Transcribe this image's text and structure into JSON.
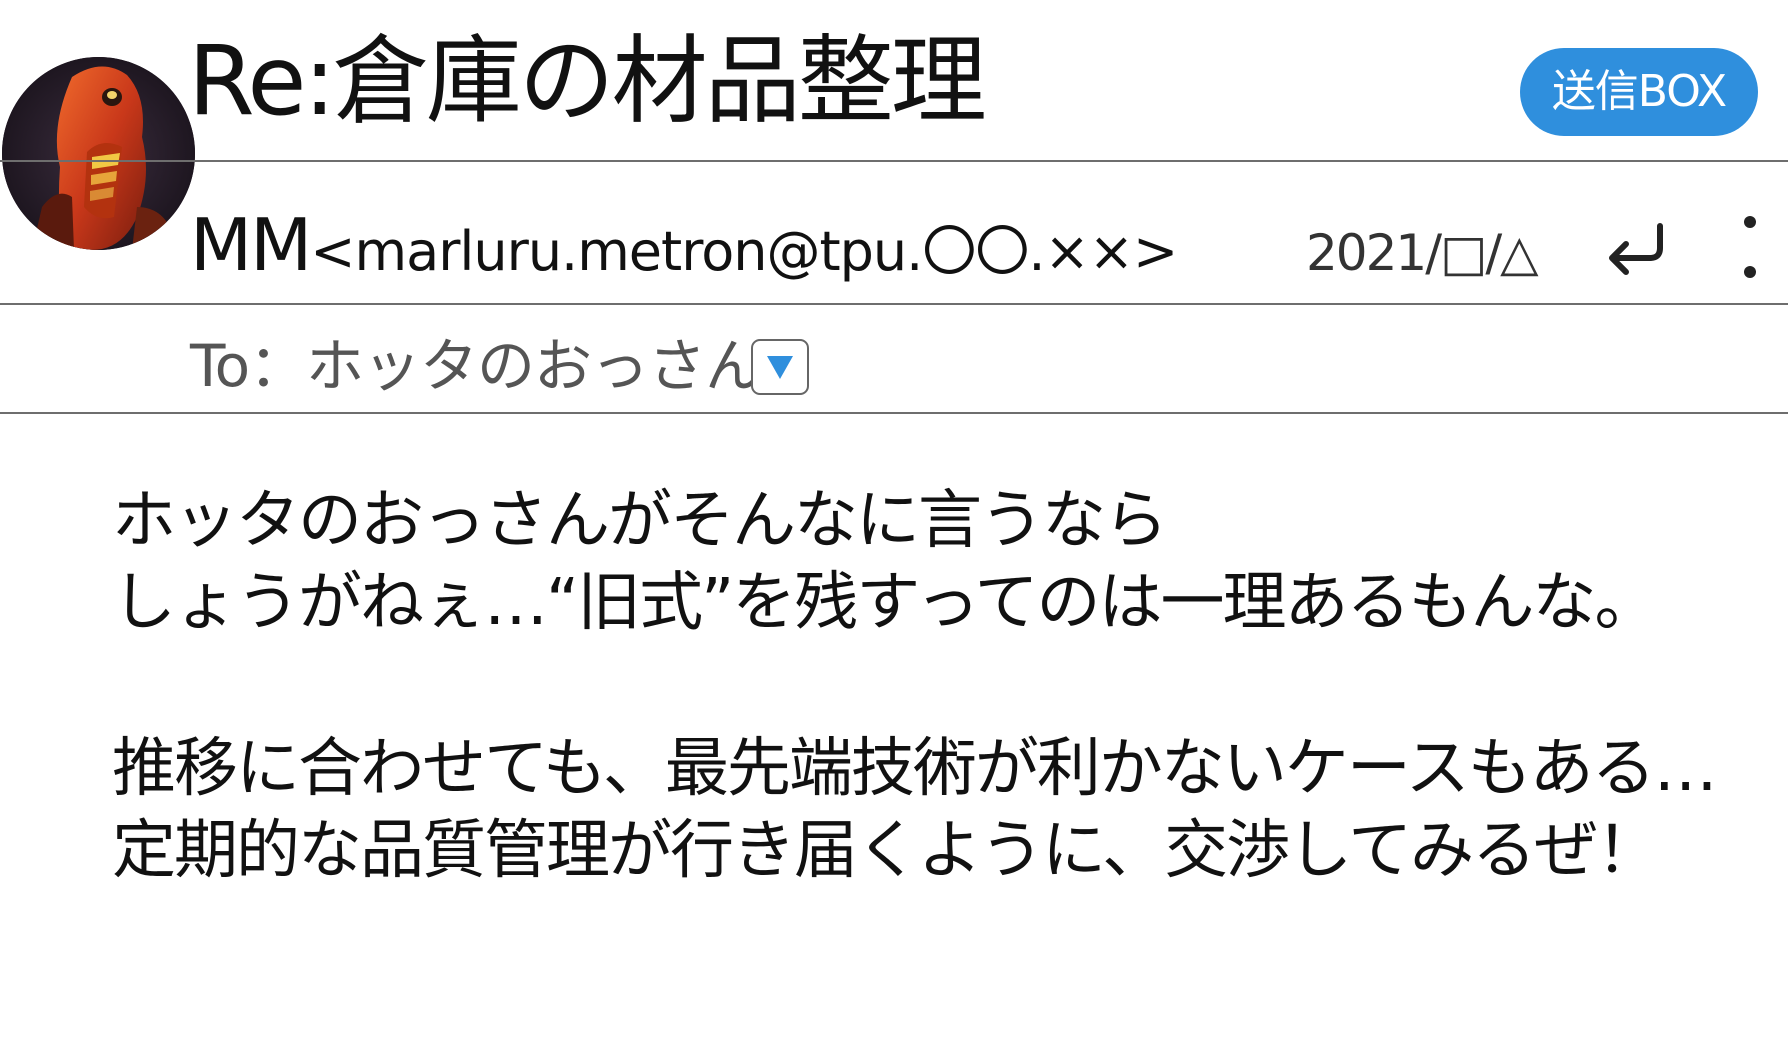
{
  "header": {
    "subject": "Re:倉庫の材品整理",
    "folder_badge": "送信BOX"
  },
  "message": {
    "sender_name": "MM",
    "sender_email": "<marluru.metron@tpu.〇〇.××>",
    "date": "2021/□/△",
    "recipient_label": "To：ホッタのおっさん",
    "body": {
      "paragraph1": {
        "line1": "ホッタのおっさんがそんなに言うなら",
        "line2": "しょうがねぇ…“旧式”を残すってのは一理あるもんな。"
      },
      "paragraph2": {
        "line1": "推移に合わせても、最先端技術が利かないケースもある…",
        "line2": "定期的な品質管理が行き届くように、交渉してみるぜ！"
      }
    }
  },
  "icons": {
    "avatar": "avatar-photo",
    "reply": "reply-icon",
    "more": "more-vertical-icon",
    "dropdown": "triangle-down-icon"
  },
  "colors": {
    "accent": "#2f8fdd",
    "divider": "#6e6e6e",
    "text": "#111111"
  }
}
